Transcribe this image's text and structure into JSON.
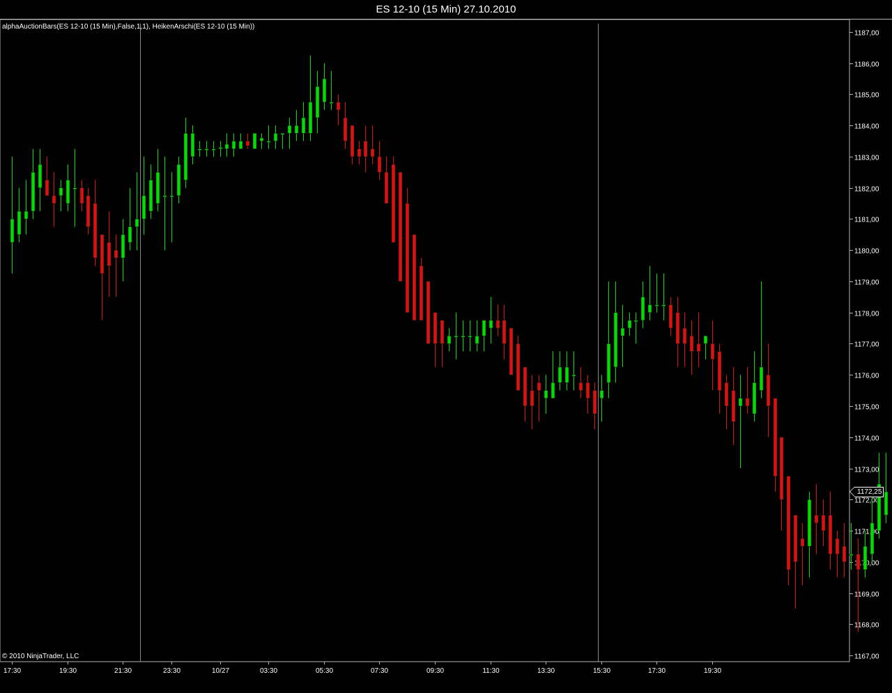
{
  "window": {
    "title": "ES 12-10 (15 Min)  27.10.2010"
  },
  "indicator_label": "alphaAuctionBars(ES 12-10 (15 Min),False,1,1), HeikenArschi(ES 12-10 (15 Min))",
  "copyright": "© 2010 NinjaTrader, LLC",
  "last_price_label": "1172,25",
  "colors": {
    "background": "#000000",
    "up": "#00e000",
    "down": "#e01010",
    "axis": "#b4b4b4",
    "text": "#ffffff"
  },
  "chart_data": {
    "type": "candlestick",
    "title": "ES 12-10 (15 Min)  27.10.2010",
    "y_range": [
      1166.8,
      1187.4
    ],
    "y_ticks": [
      1187,
      1186,
      1185,
      1184,
      1183,
      1182,
      1181,
      1180,
      1179,
      1178,
      1177,
      1176,
      1175,
      1174,
      1173,
      1172,
      1171,
      1170,
      1169,
      1168,
      1167
    ],
    "y_tick_labels": [
      "1187,00",
      "1186,00",
      "1185,00",
      "1184,00",
      "1183,00",
      "1182,00",
      "1181,00",
      "1180,00",
      "1179,00",
      "1178,00",
      "1177,00",
      "1176,00",
      "1175,00",
      "1174,00",
      "1173,00",
      "1172,00",
      "1171,00",
      "1170,00",
      "1169,00",
      "1168,00",
      "1167,00"
    ],
    "x_tick_labels": [
      "17:30",
      "19:30",
      "21:30",
      "23:30",
      "10/27",
      "03:30",
      "05:30",
      "07:30",
      "09:30",
      "11:30",
      "13:30",
      "15:30",
      "17:30",
      "19:30"
    ],
    "x_tick_bar_index": [
      0,
      8,
      16,
      23,
      30,
      37,
      45,
      53,
      61,
      69,
      77,
      85,
      93,
      101
    ],
    "session_break_bar_index": [
      19,
      85
    ],
    "last_price": 1172.25,
    "grid": false,
    "candles": [
      {
        "o": 1180.25,
        "h": 1183.0,
        "l": 1179.25,
        "c": 1181.0
      },
      {
        "o": 1180.5,
        "h": 1182.0,
        "l": 1180.25,
        "c": 1181.25
      },
      {
        "o": 1181.0,
        "h": 1182.25,
        "l": 1180.5,
        "c": 1181.25
      },
      {
        "o": 1181.25,
        "h": 1183.25,
        "l": 1181.0,
        "c": 1182.5
      },
      {
        "o": 1182.0,
        "h": 1183.25,
        "l": 1181.25,
        "c": 1182.75
      },
      {
        "o": 1182.25,
        "h": 1183.0,
        "l": 1181.75,
        "c": 1181.75
      },
      {
        "o": 1181.75,
        "h": 1182.5,
        "l": 1180.75,
        "c": 1181.5
      },
      {
        "o": 1181.75,
        "h": 1182.25,
        "l": 1181.25,
        "c": 1182.0
      },
      {
        "o": 1181.5,
        "h": 1182.75,
        "l": 1181.25,
        "c": 1182.25
      },
      {
        "o": 1182.0,
        "h": 1183.25,
        "l": 1180.75,
        "c": 1182.0
      },
      {
        "o": 1182.0,
        "h": 1182.25,
        "l": 1181.25,
        "c": 1181.5
      },
      {
        "o": 1181.75,
        "h": 1182.0,
        "l": 1180.5,
        "c": 1180.75
      },
      {
        "o": 1181.5,
        "h": 1182.25,
        "l": 1179.5,
        "c": 1179.75
      },
      {
        "o": 1180.5,
        "h": 1180.5,
        "l": 1177.75,
        "c": 1179.25
      },
      {
        "o": 1180.25,
        "h": 1181.25,
        "l": 1178.5,
        "c": 1179.5
      },
      {
        "o": 1180.0,
        "h": 1180.5,
        "l": 1178.5,
        "c": 1179.75
      },
      {
        "o": 1179.75,
        "h": 1181.0,
        "l": 1179.0,
        "c": 1180.5
      },
      {
        "o": 1180.25,
        "h": 1182.0,
        "l": 1180.0,
        "c": 1180.75
      },
      {
        "o": 1180.75,
        "h": 1182.5,
        "l": 1180.0,
        "c": 1181.0
      },
      {
        "o": 1181.0,
        "h": 1183.0,
        "l": 1180.5,
        "c": 1181.75
      },
      {
        "o": 1181.25,
        "h": 1182.75,
        "l": 1181.0,
        "c": 1182.25
      },
      {
        "o": 1181.5,
        "h": 1183.25,
        "l": 1181.25,
        "c": 1182.5
      },
      {
        "o": 1181.75,
        "h": 1183.0,
        "l": 1180.0,
        "c": 1181.75
      },
      {
        "o": 1181.75,
        "h": 1182.5,
        "l": 1180.25,
        "c": 1181.75
      },
      {
        "o": 1181.75,
        "h": 1183.0,
        "l": 1181.5,
        "c": 1182.75
      },
      {
        "o": 1182.25,
        "h": 1184.25,
        "l": 1182.0,
        "c": 1183.75
      },
      {
        "o": 1183.0,
        "h": 1184.0,
        "l": 1182.75,
        "c": 1183.75
      },
      {
        "o": 1183.25,
        "h": 1183.5,
        "l": 1183.0,
        "c": 1183.25
      },
      {
        "o": 1183.25,
        "h": 1183.5,
        "l": 1183.0,
        "c": 1183.25
      },
      {
        "o": 1183.25,
        "h": 1183.5,
        "l": 1183.0,
        "c": 1183.25
      },
      {
        "o": 1183.25,
        "h": 1183.5,
        "l": 1183.0,
        "c": 1183.3
      },
      {
        "o": 1183.25,
        "h": 1183.75,
        "l": 1183.0,
        "c": 1183.4
      },
      {
        "o": 1183.25,
        "h": 1183.75,
        "l": 1183.0,
        "c": 1183.5
      },
      {
        "o": 1183.25,
        "h": 1183.75,
        "l": 1183.25,
        "c": 1183.5
      },
      {
        "o": 1183.5,
        "h": 1183.75,
        "l": 1183.25,
        "c": 1183.35
      },
      {
        "o": 1183.25,
        "h": 1183.75,
        "l": 1183.25,
        "c": 1183.75
      },
      {
        "o": 1183.5,
        "h": 1183.75,
        "l": 1183.25,
        "c": 1183.6
      },
      {
        "o": 1183.5,
        "h": 1184.0,
        "l": 1183.25,
        "c": 1183.5
      },
      {
        "o": 1183.5,
        "h": 1184.0,
        "l": 1183.25,
        "c": 1183.75
      },
      {
        "o": 1183.75,
        "h": 1183.75,
        "l": 1183.25,
        "c": 1183.75
      },
      {
        "o": 1183.75,
        "h": 1184.25,
        "l": 1183.25,
        "c": 1184.0
      },
      {
        "o": 1183.75,
        "h": 1184.5,
        "l": 1183.5,
        "c": 1184.0
      },
      {
        "o": 1183.75,
        "h": 1184.75,
        "l": 1183.5,
        "c": 1184.25
      },
      {
        "o": 1183.75,
        "h": 1186.25,
        "l": 1183.5,
        "c": 1184.75
      },
      {
        "o": 1184.25,
        "h": 1185.75,
        "l": 1183.75,
        "c": 1185.25
      },
      {
        "o": 1184.75,
        "h": 1186.0,
        "l": 1184.5,
        "c": 1185.5
      },
      {
        "o": 1184.75,
        "h": 1185.75,
        "l": 1184.5,
        "c": 1184.75
      },
      {
        "o": 1184.75,
        "h": 1185.0,
        "l": 1184.0,
        "c": 1184.5
      },
      {
        "o": 1184.25,
        "h": 1184.75,
        "l": 1183.25,
        "c": 1183.5
      },
      {
        "o": 1184.0,
        "h": 1184.0,
        "l": 1182.75,
        "c": 1183.0
      },
      {
        "o": 1183.25,
        "h": 1183.5,
        "l": 1182.75,
        "c": 1183.0
      },
      {
        "o": 1183.5,
        "h": 1184.0,
        "l": 1182.5,
        "c": 1183.0
      },
      {
        "o": 1183.25,
        "h": 1184.0,
        "l": 1182.75,
        "c": 1183.0
      },
      {
        "o": 1183.0,
        "h": 1183.5,
        "l": 1182.25,
        "c": 1182.5
      },
      {
        "o": 1182.5,
        "h": 1183.0,
        "l": 1182.0,
        "c": 1181.5
      },
      {
        "o": 1182.75,
        "h": 1183.0,
        "l": 1181.0,
        "c": 1180.25
      },
      {
        "o": 1182.5,
        "h": 1182.5,
        "l": 1179.0,
        "c": 1179.0
      },
      {
        "o": 1181.5,
        "h": 1182.0,
        "l": 1178.0,
        "c": 1178.0
      },
      {
        "o": 1180.5,
        "h": 1180.5,
        "l": 1177.75,
        "c": 1177.75
      },
      {
        "o": 1179.5,
        "h": 1179.75,
        "l": 1177.75,
        "c": 1177.75
      },
      {
        "o": 1179.0,
        "h": 1179.0,
        "l": 1177.0,
        "c": 1177.0
      },
      {
        "o": 1178.0,
        "h": 1178.0,
        "l": 1176.25,
        "c": 1177.0
      },
      {
        "o": 1177.75,
        "h": 1177.75,
        "l": 1176.25,
        "c": 1177.0
      },
      {
        "o": 1177.0,
        "h": 1177.5,
        "l": 1176.75,
        "c": 1177.25
      },
      {
        "o": 1177.25,
        "h": 1178.0,
        "l": 1176.5,
        "c": 1177.25
      },
      {
        "o": 1177.25,
        "h": 1177.75,
        "l": 1176.75,
        "c": 1177.25
      },
      {
        "o": 1177.25,
        "h": 1177.75,
        "l": 1176.75,
        "c": 1177.25
      },
      {
        "o": 1177.0,
        "h": 1177.75,
        "l": 1176.75,
        "c": 1177.25
      },
      {
        "o": 1177.25,
        "h": 1177.75,
        "l": 1176.75,
        "c": 1177.75
      },
      {
        "o": 1177.5,
        "h": 1178.5,
        "l": 1177.0,
        "c": 1177.75
      },
      {
        "o": 1177.75,
        "h": 1178.25,
        "l": 1177.25,
        "c": 1177.5
      },
      {
        "o": 1177.75,
        "h": 1178.25,
        "l": 1176.5,
        "c": 1177.0
      },
      {
        "o": 1177.5,
        "h": 1177.5,
        "l": 1176.0,
        "c": 1176.0
      },
      {
        "o": 1177.0,
        "h": 1177.25,
        "l": 1175.5,
        "c": 1175.5
      },
      {
        "o": 1176.25,
        "h": 1176.25,
        "l": 1174.5,
        "c": 1175.0
      },
      {
        "o": 1175.5,
        "h": 1176.0,
        "l": 1174.25,
        "c": 1175.0
      },
      {
        "o": 1175.75,
        "h": 1176.0,
        "l": 1174.5,
        "c": 1175.5
      },
      {
        "o": 1175.25,
        "h": 1176.0,
        "l": 1174.75,
        "c": 1175.5
      },
      {
        "o": 1175.25,
        "h": 1176.75,
        "l": 1175.25,
        "c": 1175.75
      },
      {
        "o": 1175.75,
        "h": 1176.75,
        "l": 1175.5,
        "c": 1176.25
      },
      {
        "o": 1175.75,
        "h": 1176.75,
        "l": 1175.5,
        "c": 1176.25
      },
      {
        "o": 1176.0,
        "h": 1176.75,
        "l": 1175.5,
        "c": 1176.0
      },
      {
        "o": 1175.75,
        "h": 1176.25,
        "l": 1175.25,
        "c": 1175.5
      },
      {
        "o": 1175.75,
        "h": 1176.0,
        "l": 1174.75,
        "c": 1175.25
      },
      {
        "o": 1175.5,
        "h": 1175.75,
        "l": 1174.25,
        "c": 1174.75
      },
      {
        "o": 1175.25,
        "h": 1176.0,
        "l": 1174.5,
        "c": 1175.5
      },
      {
        "o": 1175.75,
        "h": 1179.0,
        "l": 1175.25,
        "c": 1177.0
      },
      {
        "o": 1176.25,
        "h": 1179.0,
        "l": 1175.75,
        "c": 1178.0
      },
      {
        "o": 1177.25,
        "h": 1178.25,
        "l": 1176.25,
        "c": 1177.5
      },
      {
        "o": 1177.5,
        "h": 1178.0,
        "l": 1177.25,
        "c": 1177.75
      },
      {
        "o": 1177.75,
        "h": 1178.0,
        "l": 1177.0,
        "c": 1177.75
      },
      {
        "o": 1177.75,
        "h": 1179.0,
        "l": 1177.5,
        "c": 1178.5
      },
      {
        "o": 1178.0,
        "h": 1179.5,
        "l": 1177.75,
        "c": 1178.25
      },
      {
        "o": 1178.25,
        "h": 1179.25,
        "l": 1178.0,
        "c": 1178.25
      },
      {
        "o": 1178.25,
        "h": 1179.25,
        "l": 1177.75,
        "c": 1178.25
      },
      {
        "o": 1178.25,
        "h": 1178.5,
        "l": 1177.25,
        "c": 1177.5
      },
      {
        "o": 1178.0,
        "h": 1178.5,
        "l": 1176.25,
        "c": 1177.0
      },
      {
        "o": 1177.5,
        "h": 1178.0,
        "l": 1176.25,
        "c": 1177.0
      },
      {
        "o": 1177.25,
        "h": 1177.75,
        "l": 1176.0,
        "c": 1176.75
      },
      {
        "o": 1177.0,
        "h": 1178.0,
        "l": 1176.25,
        "c": 1176.75
      },
      {
        "o": 1177.0,
        "h": 1177.25,
        "l": 1176.5,
        "c": 1177.25
      },
      {
        "o": 1177.0,
        "h": 1177.75,
        "l": 1175.5,
        "c": 1176.5
      },
      {
        "o": 1176.75,
        "h": 1177.0,
        "l": 1174.75,
        "c": 1175.5
      },
      {
        "o": 1175.75,
        "h": 1176.0,
        "l": 1174.25,
        "c": 1175.0
      },
      {
        "o": 1175.5,
        "h": 1176.25,
        "l": 1173.75,
        "c": 1174.5
      },
      {
        "o": 1175.0,
        "h": 1176.0,
        "l": 1173.0,
        "c": 1175.25
      },
      {
        "o": 1175.25,
        "h": 1176.25,
        "l": 1174.75,
        "c": 1175.0
      },
      {
        "o": 1174.75,
        "h": 1176.75,
        "l": 1174.5,
        "c": 1175.75
      },
      {
        "o": 1175.5,
        "h": 1179.0,
        "l": 1175.25,
        "c": 1176.25
      },
      {
        "o": 1176.0,
        "h": 1177.0,
        "l": 1174.0,
        "c": 1175.0
      },
      {
        "o": 1175.25,
        "h": 1175.25,
        "l": 1172.25,
        "c": 1172.75
      },
      {
        "o": 1174.0,
        "h": 1174.0,
        "l": 1171.0,
        "c": 1172.0
      },
      {
        "o": 1172.75,
        "h": 1172.75,
        "l": 1169.25,
        "c": 1169.75
      },
      {
        "o": 1171.5,
        "h": 1171.5,
        "l": 1168.5,
        "c": 1170.0
      },
      {
        "o": 1170.75,
        "h": 1171.25,
        "l": 1169.25,
        "c": 1170.5
      },
      {
        "o": 1170.5,
        "h": 1172.25,
        "l": 1169.5,
        "c": 1172.0
      },
      {
        "o": 1171.5,
        "h": 1172.5,
        "l": 1170.25,
        "c": 1171.25
      },
      {
        "o": 1171.5,
        "h": 1172.0,
        "l": 1170.5,
        "c": 1171.0
      },
      {
        "o": 1171.5,
        "h": 1172.25,
        "l": 1169.75,
        "c": 1170.25
      },
      {
        "o": 1170.75,
        "h": 1171.0,
        "l": 1169.5,
        "c": 1170.25
      },
      {
        "o": 1170.5,
        "h": 1171.25,
        "l": 1169.5,
        "c": 1170.0
      },
      {
        "o": 1170.25,
        "h": 1171.25,
        "l": 1169.75,
        "c": 1170.25
      },
      {
        "o": 1170.25,
        "h": 1170.75,
        "l": 1167.75,
        "c": 1169.75
      },
      {
        "o": 1169.75,
        "h": 1171.0,
        "l": 1169.5,
        "c": 1170.5
      },
      {
        "o": 1170.25,
        "h": 1172.25,
        "l": 1170.0,
        "c": 1171.25
      },
      {
        "o": 1171.0,
        "h": 1173.5,
        "l": 1170.75,
        "c": 1172.5
      },
      {
        "o": 1171.5,
        "h": 1173.5,
        "l": 1171.25,
        "c": 1172.25
      }
    ]
  }
}
